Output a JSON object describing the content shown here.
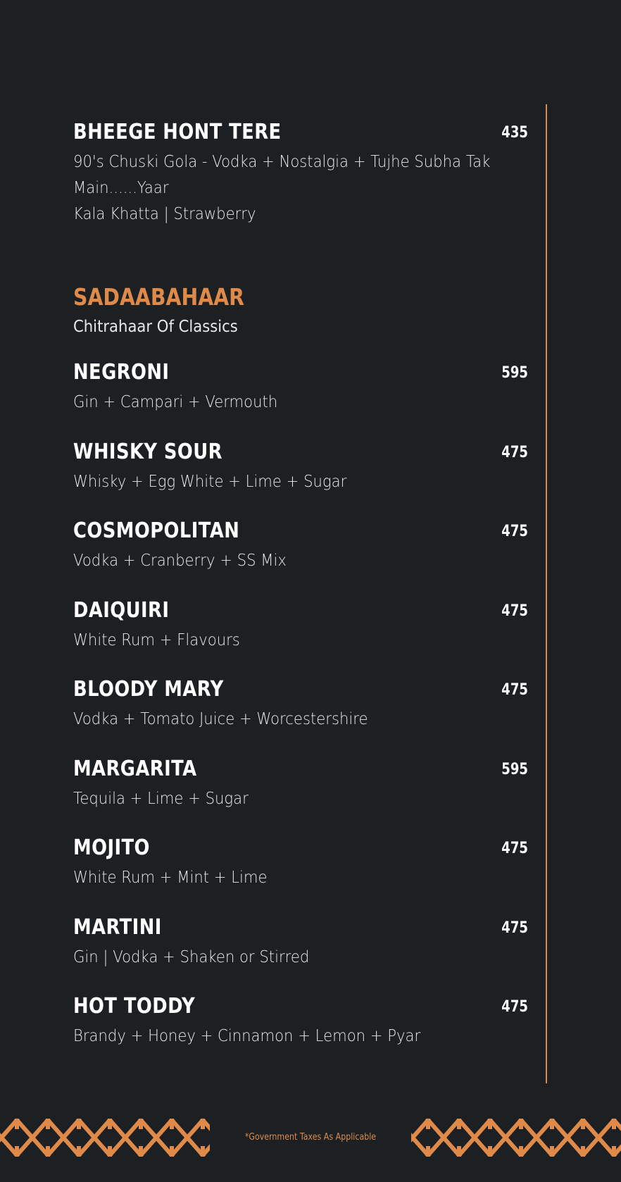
{
  "featured": {
    "name": "BHEEGE HONT TERE",
    "price": "435",
    "desc_lines": [
      "90's Chuski Gola - Vodka + Nostalgia + Tujhe Subha Tak",
      "Main......Yaar",
      "Kala Khatta | Strawberry"
    ]
  },
  "section": {
    "title": "SADAABAHAAR",
    "subtitle": "Chitrahaar Of Classics"
  },
  "items": [
    {
      "name": "NEGRONI",
      "price": "595",
      "desc": "Gin + Campari + Vermouth"
    },
    {
      "name": "WHISKY SOUR",
      "price": "475",
      "desc": "Whisky + Egg White + Lime + Sugar"
    },
    {
      "name": "COSMOPOLITAN",
      "price": "475",
      "desc": "Vodka + Cranberry + SS Mix"
    },
    {
      "name": "DAIQUIRI",
      "price": "475",
      "desc": "White Rum + Flavours"
    },
    {
      "name": "BLOODY MARY",
      "price": "475",
      "desc": "Vodka + Tomato Juice + Worcestershire"
    },
    {
      "name": "MARGARITA",
      "price": "595",
      "desc": "Tequila + Lime + Sugar"
    },
    {
      "name": "MOJITO",
      "price": "475",
      "desc": "White Rum + Mint + Lime"
    },
    {
      "name": "MARTINI",
      "price": "475",
      "desc": "Gin | Vodka + Shaken or Stirred"
    },
    {
      "name": "HOT TODDY",
      "price": "475",
      "desc": "Brandy + Honey + Cinnamon + Lemon + Pyar"
    }
  ],
  "footer": {
    "note": "*Government Taxes As Applicable"
  },
  "colors": {
    "background": "#1d2022",
    "accent": "#d98c4e",
    "text": "#ffffff"
  }
}
